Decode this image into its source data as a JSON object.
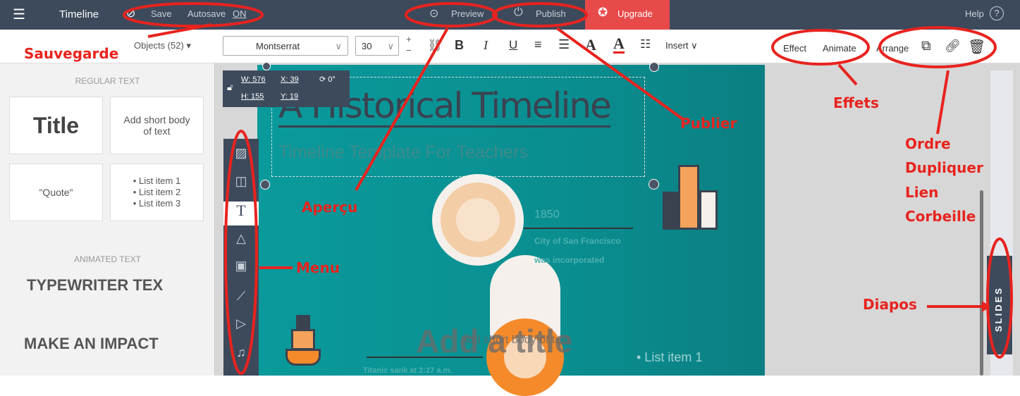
{
  "topbar": {
    "title": "Timeline",
    "save": "Save",
    "autosave_label": "Autosave",
    "autosave_state": "ON",
    "preview": "Preview",
    "publish": "Publish",
    "upgrade": "Upgrade",
    "help": "Help"
  },
  "toolbar": {
    "font": "Montserrat",
    "size": "30",
    "insert": "Insert",
    "effect": "Effect",
    "animate": "Animate",
    "arrange": "Arrange"
  },
  "leftpanel": {
    "objects": "Objects (52)",
    "regular_text": "REGULAR TEXT",
    "title_card": "Title",
    "body_card": "Add short body of text",
    "quote_card": "\"Quote\"",
    "list": [
      "• List item 1",
      "• List item 2",
      "• List item 3"
    ],
    "animated_text": "ANIMATED TEXT",
    "typewriter": "TYPEWRITER TEX",
    "impact": "MAKE AN IMPACT"
  },
  "selection": {
    "w": "W: 576",
    "h": "H: 155",
    "x": "X: 39",
    "y": "Y: 19",
    "rot": "0°"
  },
  "slide": {
    "title": "A Historical Timeline",
    "subtitle": "Timeline Template For Teachers",
    "year": "1850",
    "event1": "City of San Francisco",
    "event2": "was incorporated",
    "add_title": "Add a title",
    "shortbody": "Add short body of text",
    "list_item": "• List item 1",
    "titanic": "Titanic sank at 2:27 a.m."
  },
  "slides_tab": "SLIDES",
  "annotations": {
    "sauvegarde": "Sauvegarde",
    "apercu": "Aperçu",
    "publier": "Publier",
    "effets": "Effets",
    "ordre": "Ordre",
    "dupliquer": "Dupliquer",
    "lien": "Lien",
    "corbeille": "Corbeille",
    "menu": "Menu",
    "diapos": "Diapos"
  },
  "colors": {
    "accent": "#e8231e",
    "topbar": "#3d4a5c",
    "slide": "#0a9a9c",
    "upgrade": "#e84a4a"
  }
}
